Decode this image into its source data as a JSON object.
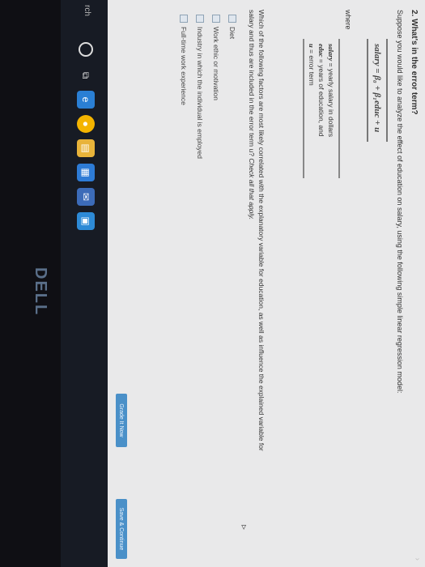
{
  "question": {
    "number": "2.",
    "title": "What's in the error term?",
    "intro": "Suppose you would like to analyze the effect of education on salary, using the following simple linear regression model:",
    "equation": "salary = β₀ + β₁educ + u",
    "where_label": "where",
    "definitions": [
      {
        "var": "salary",
        "text": " = yearly salary in dollars"
      },
      {
        "var": "educ",
        "text": " = years of education, and"
      },
      {
        "var": "u",
        "text": " = error term"
      }
    ],
    "prompt": "Which of the following factors are most likely correlated with the explanatory variable for education, as well as influence the explained variable for",
    "prompt2_a": "salary and thus are included in the error term u? ",
    "prompt2_b": "Check all that apply.",
    "options": [
      "Diet",
      "Work ethic or motivation",
      "Industry in which the individual is employed",
      "Full-time work experience"
    ]
  },
  "buttons": {
    "grade": "Grade It Now",
    "save": "Save & Continue"
  },
  "taskbar": {
    "search_fragment": "rch",
    "brand": "DELL"
  },
  "colors": {
    "accent": "#4a90c8",
    "page_bg": "#e9e9ea",
    "taskbar": "#171b24"
  }
}
